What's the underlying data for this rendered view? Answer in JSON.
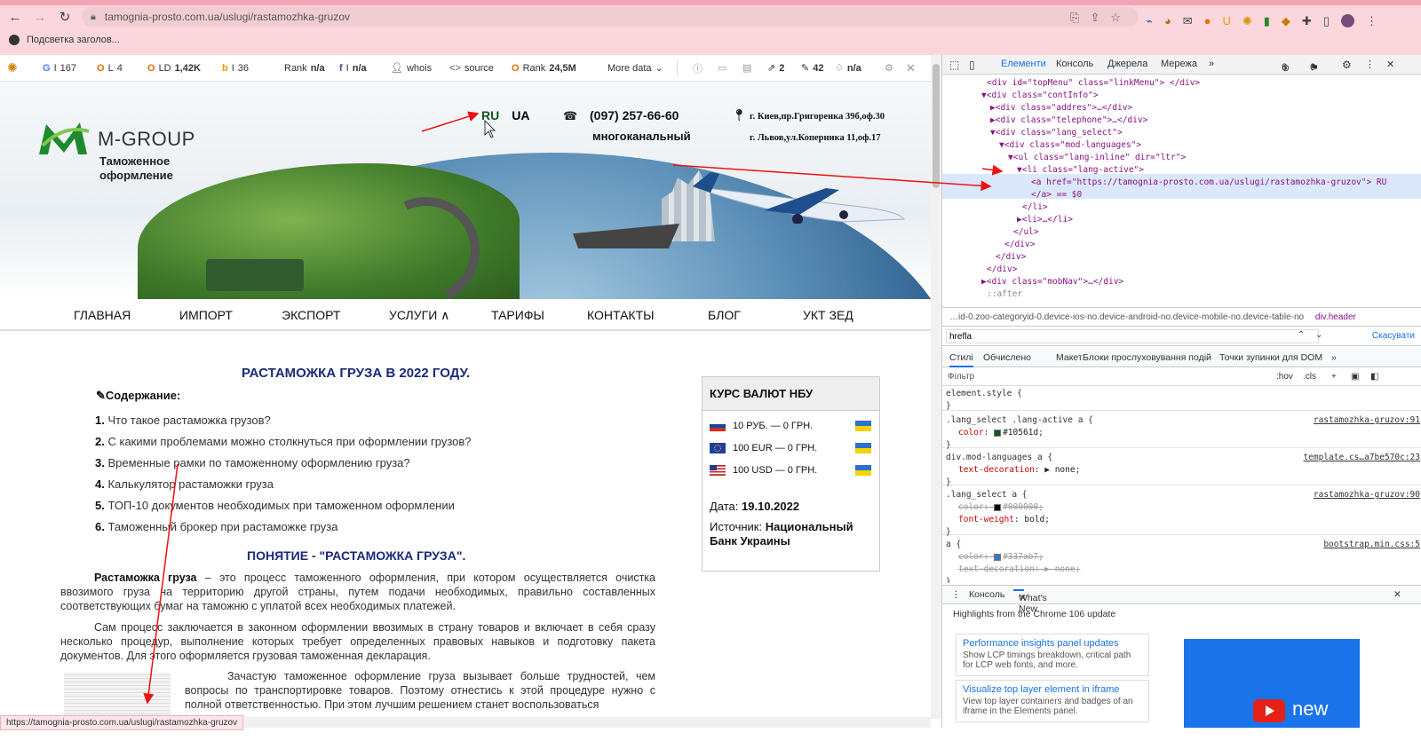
{
  "browser": {
    "url": "tamognia-prosto.com.ua/uslugi/rastamozhka-gruzov",
    "bookmark": "Подсветка заголов..."
  },
  "seo_bar": {
    "items": [
      {
        "icon": "G",
        "label": "I",
        "value": "167"
      },
      {
        "icon": "O",
        "label": "L",
        "value": "4"
      },
      {
        "icon": "O",
        "label": "LD",
        "value": "1,42K"
      },
      {
        "icon": "b",
        "label": "I",
        "value": "36"
      },
      {
        "icon": "",
        "label": "Rank",
        "value": "n/a"
      },
      {
        "icon": "f",
        "label": "I",
        "value": "n/a"
      },
      {
        "icon": "",
        "label": "whois",
        "value": ""
      },
      {
        "icon": "<>",
        "label": "source",
        "value": ""
      },
      {
        "icon": "O",
        "label": "Rank",
        "value": "24,5M"
      }
    ],
    "more": "More data",
    "right_values": [
      "2",
      "42",
      "n/a"
    ]
  },
  "site": {
    "logo_title": "M-GROUP",
    "logo_sub": "Таможенное оформление",
    "lang_ru": "RU",
    "lang_ua": "UA",
    "phone": "(097) 257-66-60",
    "phone_note": "многоканальный",
    "address1": "г. Киев,пр.Григоренка 39б,оф.30",
    "address2": "г. Львов,ул.Коперника 11,оф.17",
    "menu": [
      "ГЛАВНАЯ",
      "ИМПОРТ",
      "ЭКСПОРТ",
      "УСЛУГИ ∧",
      "ТАРИФЫ",
      "КОНТАКТЫ",
      "БЛОГ",
      "УКТ ЗЕД"
    ],
    "heading": "РАСТАМОЖКА ГРУЗА В 2022 ГОДУ.",
    "toc_title": "✎Содержание:",
    "toc": [
      {
        "n": "1.",
        "t": "Что такое растаможка грузов?"
      },
      {
        "n": "2.",
        "t": "С какими проблемами можно столкнуться при оформлении грузов?"
      },
      {
        "n": "3.",
        "t": "Временные рамки по таможенному оформлению груза?"
      },
      {
        "n": "4.",
        "t": "Калькулятор растаможки груза"
      },
      {
        "n": "5.",
        "t": "ТОП-10 документов необходимых при таможенном оформлении"
      },
      {
        "n": "6.",
        "t": "Таможенный брокер при растаможке груза"
      }
    ],
    "heading2": "ПОНЯТИЕ - \"РАСТАМОЖКА ГРУЗА\".",
    "p1_bold": "Растаможка груза",
    "p1": " – это процесс таможенного оформления, при котором осуществляется очистка ввозимого груза на территорию другой страны, путем подачи необходимых, правильно составленных соответствующих бумаг на таможню с уплатой всех необходимых платежей.",
    "p2": "Сам процесс заключается в законном оформлении ввозимых в страну товаров и включает в себя сразу несколько процедур, выполнение которых требует определенных правовых навыков и подготовку пакета документов. Для этого оформляется грузовая таможенная декларация.",
    "p3": "Зачастую таможенное оформление груза вызывает больше трудностей, чем вопросы по транспортировке товаров. Поэтому отнестись к этой процедуре нужно с полной ответственностью. При этом лучшим решением станет воспользоваться",
    "rates_title": "КУРС ВАЛЮТ НБУ",
    "rates": [
      "10 РУБ. — 0 ГРН.",
      "100 EUR — 0 ГРН.",
      "100 USD — 0 ГРН."
    ],
    "date_label": "Дата: ",
    "date": "19.10.2022",
    "source_label": "Источник: ",
    "source": "Национальный Банк Украины"
  },
  "status_url": "https://tamognia-prosto.com.ua/uslugi/rastamozhka-gruzov",
  "devtools": {
    "tabs": [
      "Елементи",
      "Консоль",
      "Джерела",
      "Мережа"
    ],
    "errors": "6",
    "warnings": "6",
    "breadcrumb": "…id-0.zoo-categoryid-0.device-ios-no.device-android-no.device-mobile-no.device-table-no",
    "breadcrumb2": "div.header",
    "search_value": "hrefla",
    "search_cancel": "Скасувати",
    "style_tabs": [
      "Стилі",
      "Обчислено",
      "Макет",
      "Блоки прослуховування подій",
      "Точки зупинки для DOM"
    ],
    "filter": "Фільтр",
    "filter_hov": ":hov",
    "filter_cls": ".cls",
    "drawer_tabs": [
      "Консоль",
      "What's New"
    ],
    "highlights": "Highlights from the Chrome 106 update",
    "cards": [
      {
        "title": "Performance insights panel updates",
        "desc": "Show LCP timings breakdown, critical path for LCP web fonts, and more."
      },
      {
        "title": "Visualize top layer element in iframe",
        "desc": "View top layer containers and badges of an iframe in the Elements panel."
      }
    ],
    "promo": "new",
    "dom_lines": [
      "<div id=\"topMenu\" class=\"linkMenu\"> </div>",
      "▼<div class=\"contInfo\">",
      "▶<div class=\"addres\">…</div>",
      "▶<div class=\"telephone\">…</div>",
      "▼<div class=\"lang_select\">",
      "▼<div class=\"mod-languages\">",
      "▼<ul class=\"lang-inline\" dir=\"ltr\">",
      "▼<li class=\"lang-active\">",
      "<a href=\"https://tamognia-prosto.com.ua/uslugi/rastamozhka-gruzov\"> RU",
      "</a> == $0",
      "</li>",
      "▶<li>…</li>",
      "</ul>",
      "</div>",
      "</div>",
      "</div>",
      "▶<div class=\"mobNav\">…</div>",
      "::after"
    ],
    "rules": [
      {
        "sel": "element.style {",
        "src": "",
        "props": [],
        "end": "}"
      },
      {
        "sel": ".lang_select .lang-active a {",
        "src": "rastamozhka-gruzov:91",
        "props": [
          {
            "p": "color",
            "v": "#10561d",
            "sw": "#10561d",
            "s": false
          }
        ],
        "end": "}"
      },
      {
        "sel": "div.mod-languages a {",
        "src": "template.cs…a7be570c:23",
        "props": [
          {
            "p": "text-decoration",
            "v": "▶ none",
            "sw": "",
            "s": false
          }
        ],
        "end": "}"
      },
      {
        "sel": ".lang_select a {",
        "src": "rastamozhka-gruzov:90",
        "props": [
          {
            "p": "color",
            "v": "#000000",
            "sw": "#000000",
            "s": true
          },
          {
            "p": "font-weight",
            "v": "bold",
            "sw": "",
            "s": false
          }
        ],
        "end": "}"
      },
      {
        "sel": "a {",
        "src": "bootstrap.min.css:5",
        "props": [
          {
            "p": "color",
            "v": "#337ab7",
            "sw": "#337ab7",
            "s": true
          },
          {
            "p": "text-decoration",
            "v": "▶ none",
            "sw": "",
            "s": true
          }
        ],
        "end": "}"
      }
    ]
  },
  "colors": {
    "active_lang": "#10561d",
    "heading": "#1a2a7a",
    "chrome_pink": "#fbd7dd"
  }
}
